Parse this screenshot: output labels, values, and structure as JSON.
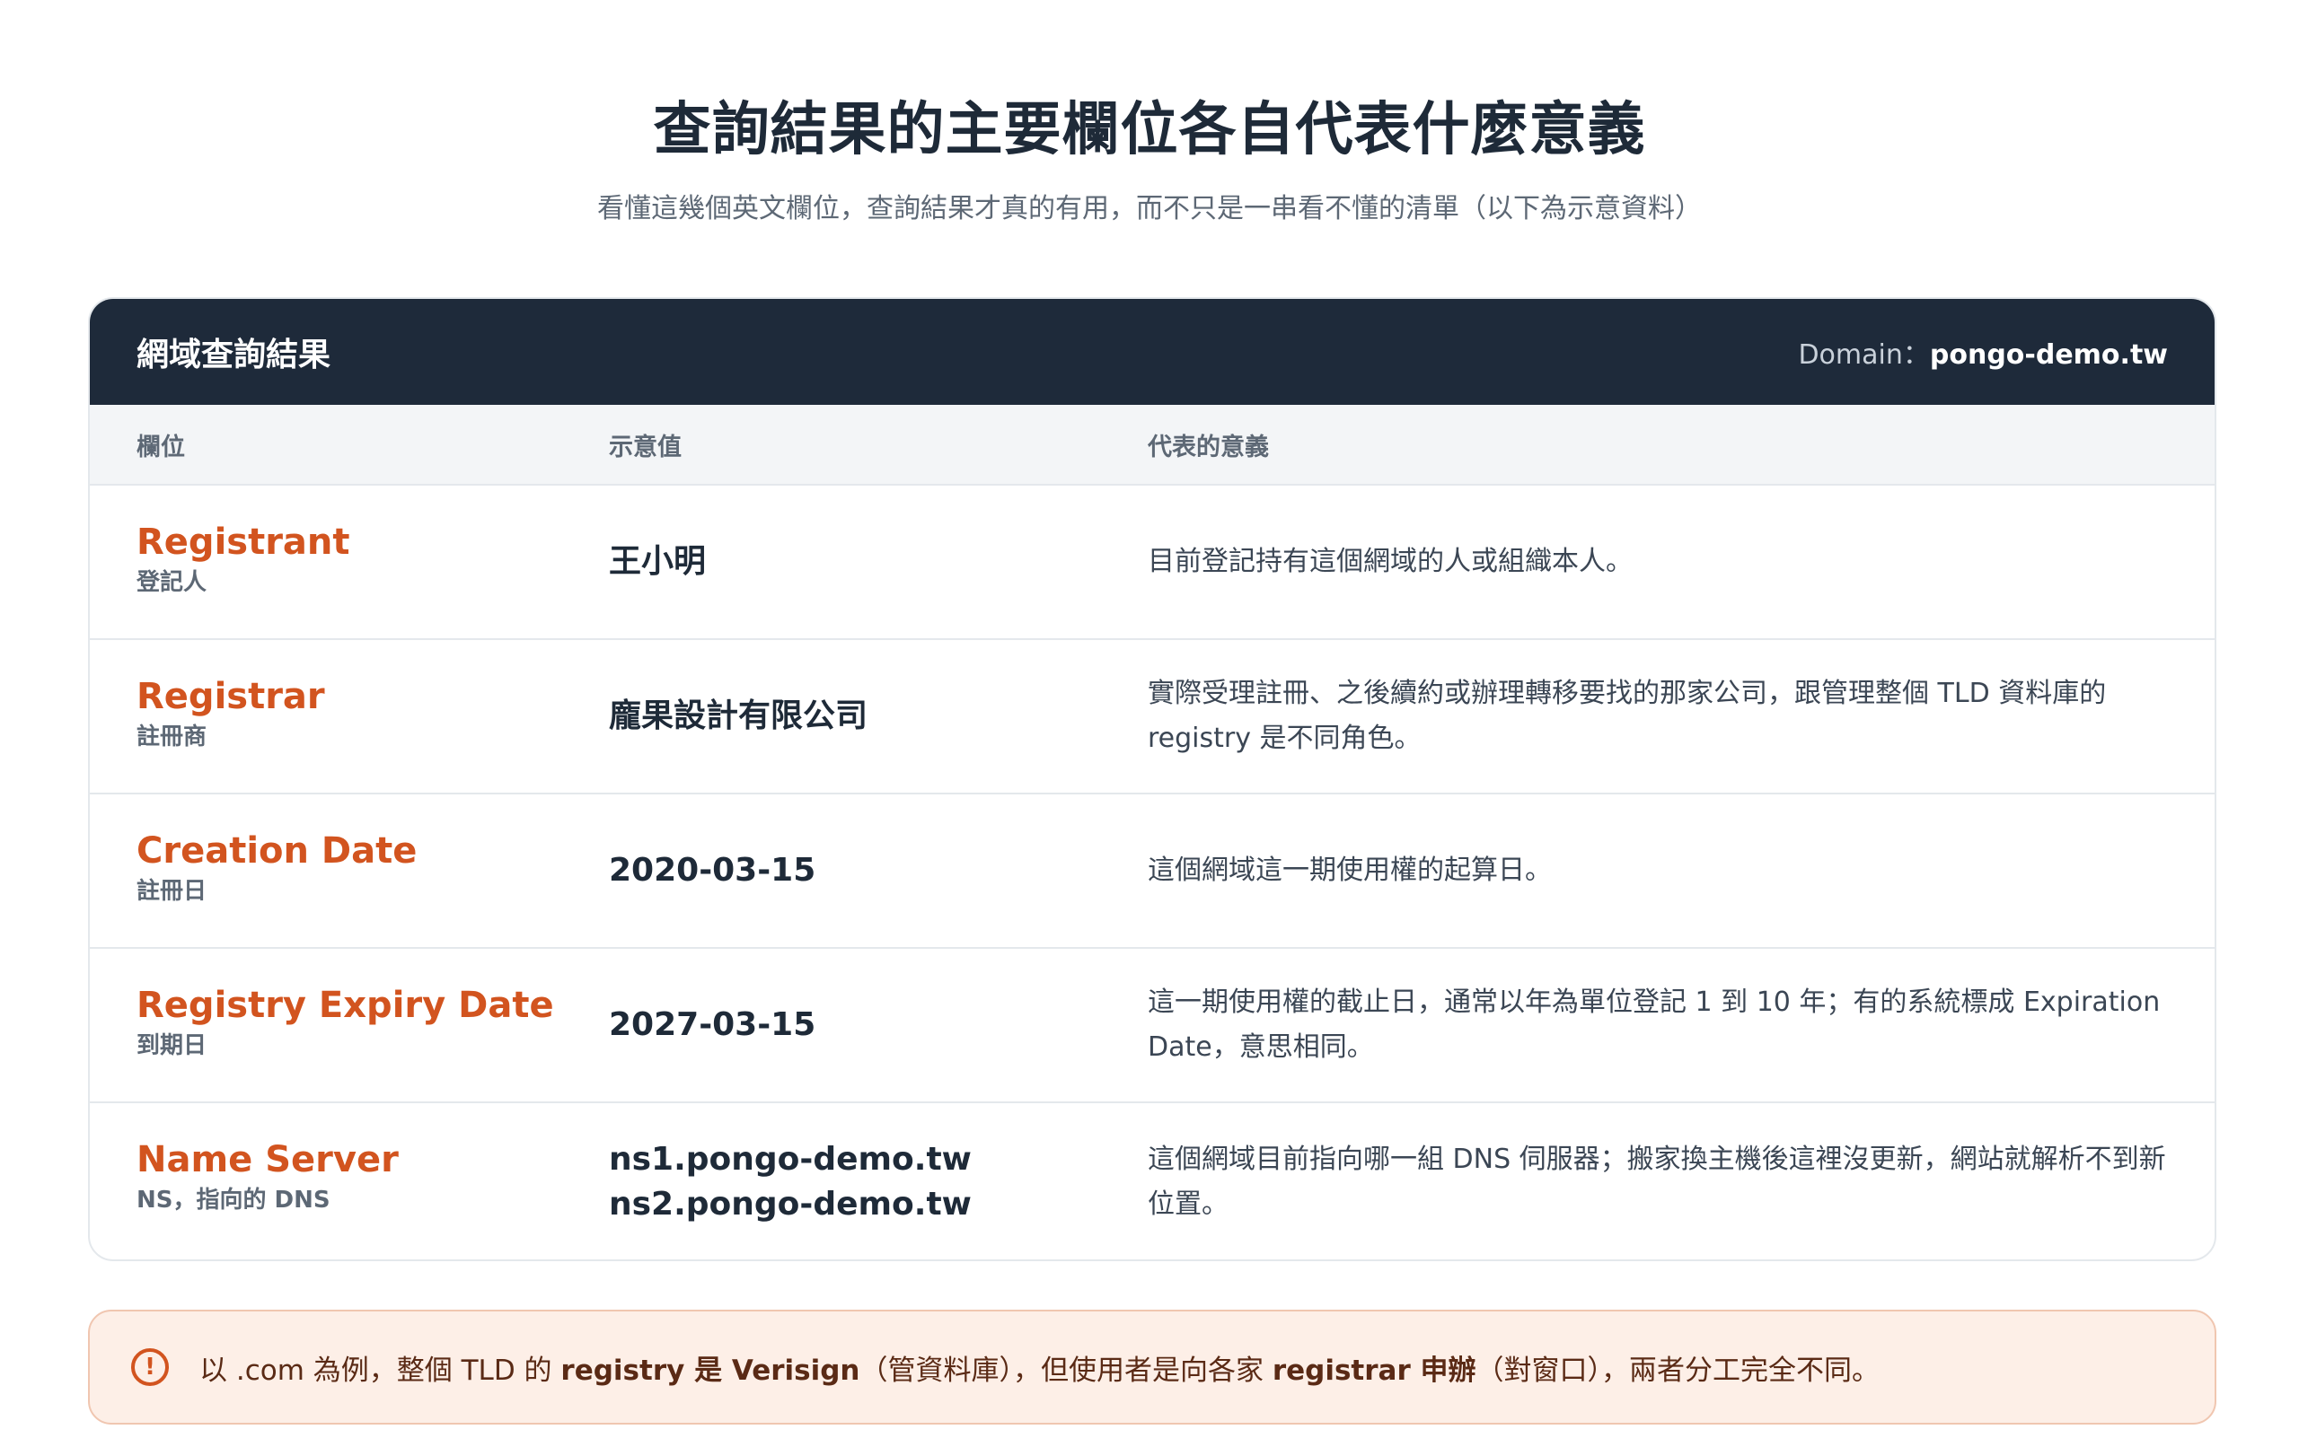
{
  "title": "查詢結果的主要欄位各自代表什麼意義",
  "subtitle": "看懂這幾個英文欄位，查詢結果才真的有用，而不只是一串看不懂的清單（以下為示意資料）",
  "card": {
    "title": "網域查詢結果",
    "domain_label": "Domain：",
    "domain_value": "pongo-demo.tw"
  },
  "columns": [
    "欄位",
    "示意值",
    "代表的意義"
  ],
  "rows": [
    {
      "field_en": "Registrant",
      "field_zh": "登記人",
      "value": "王小明",
      "meaning": "目前登記持有這個網域的人或組織本人。"
    },
    {
      "field_en": "Registrar",
      "field_zh": "註冊商",
      "value": "龐果設計有限公司",
      "meaning": "實際受理註冊、之後續約或辦理轉移要找的那家公司，跟管理整個 TLD 資料庫的 registry 是不同角色。"
    },
    {
      "field_en": "Creation Date",
      "field_zh": "註冊日",
      "value": "2020-03-15",
      "meaning": "這個網域這一期使用權的起算日。"
    },
    {
      "field_en": "Registry Expiry Date",
      "field_zh": "到期日",
      "value": "2027-03-15",
      "meaning": "這一期使用權的截止日，通常以年為單位登記 1 到 10 年；有的系統標成 Expiration Date，意思相同。"
    },
    {
      "field_en": "Name Server",
      "field_zh": "NS，指向的 DNS",
      "value": "ns1.pongo-demo.tw",
      "value2": "ns2.pongo-demo.tw",
      "meaning": "這個網域目前指向哪一組 DNS 伺服器；搬家換主機後這裡沒更新，網站就解析不到新位置。"
    }
  ],
  "note": {
    "icon": "alert-circle-icon",
    "part1": "以 .com 為例，整個 TLD 的 ",
    "bold1": "registry 是 Verisign",
    "part2": "（管資料庫），但使用者是向各家 ",
    "bold2": "registrar 申辦",
    "part3": "（對窗口），兩者分工完全不同。"
  },
  "colors": {
    "accent": "#d2541f",
    "header_bg": "#1e2a3a",
    "note_bg": "#fdefe7"
  }
}
